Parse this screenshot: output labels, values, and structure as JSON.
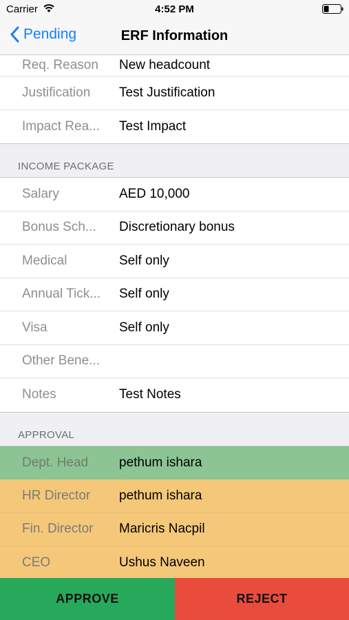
{
  "status_bar": {
    "carrier": "Carrier",
    "time": "4:52 PM"
  },
  "nav": {
    "back_label": "Pending",
    "title": "ERF Information"
  },
  "top_rows": [
    {
      "label": "Req. Reason",
      "value": "New headcount"
    },
    {
      "label": "Justification",
      "value": "Test Justification"
    },
    {
      "label": "Impact Rea...",
      "value": "Test Impact"
    }
  ],
  "income_package": {
    "header": "INCOME PACKAGE",
    "rows": [
      {
        "label": "Salary",
        "value": "AED 10,000"
      },
      {
        "label": "Bonus Sch...",
        "value": "Discretionary bonus"
      },
      {
        "label": "Medical",
        "value": "Self only"
      },
      {
        "label": "Annual Tick...",
        "value": "Self only"
      },
      {
        "label": "Visa",
        "value": "Self only"
      },
      {
        "label": "Other Bene...",
        "value": ""
      },
      {
        "label": "Notes",
        "value": "Test Notes"
      }
    ]
  },
  "approval": {
    "header": "APPROVAL",
    "rows": [
      {
        "label": "Dept. Head",
        "value": "pethum ishara",
        "status_color": "#8dc493"
      },
      {
        "label": "HR Director",
        "value": "pethum ishara",
        "status_color": "#f5c879"
      },
      {
        "label": "Fin. Director",
        "value": "Maricris Nacpil",
        "status_color": "#f5c879"
      },
      {
        "label": "CEO",
        "value": "Ushus Naveen",
        "status_color": "#f5c879"
      }
    ]
  },
  "actions": {
    "approve_label": "APPROVE",
    "reject_label": "REJECT",
    "approve_color": "#27a95b",
    "reject_color": "#e74c3c"
  },
  "colors": {
    "accent": "#147efb"
  }
}
